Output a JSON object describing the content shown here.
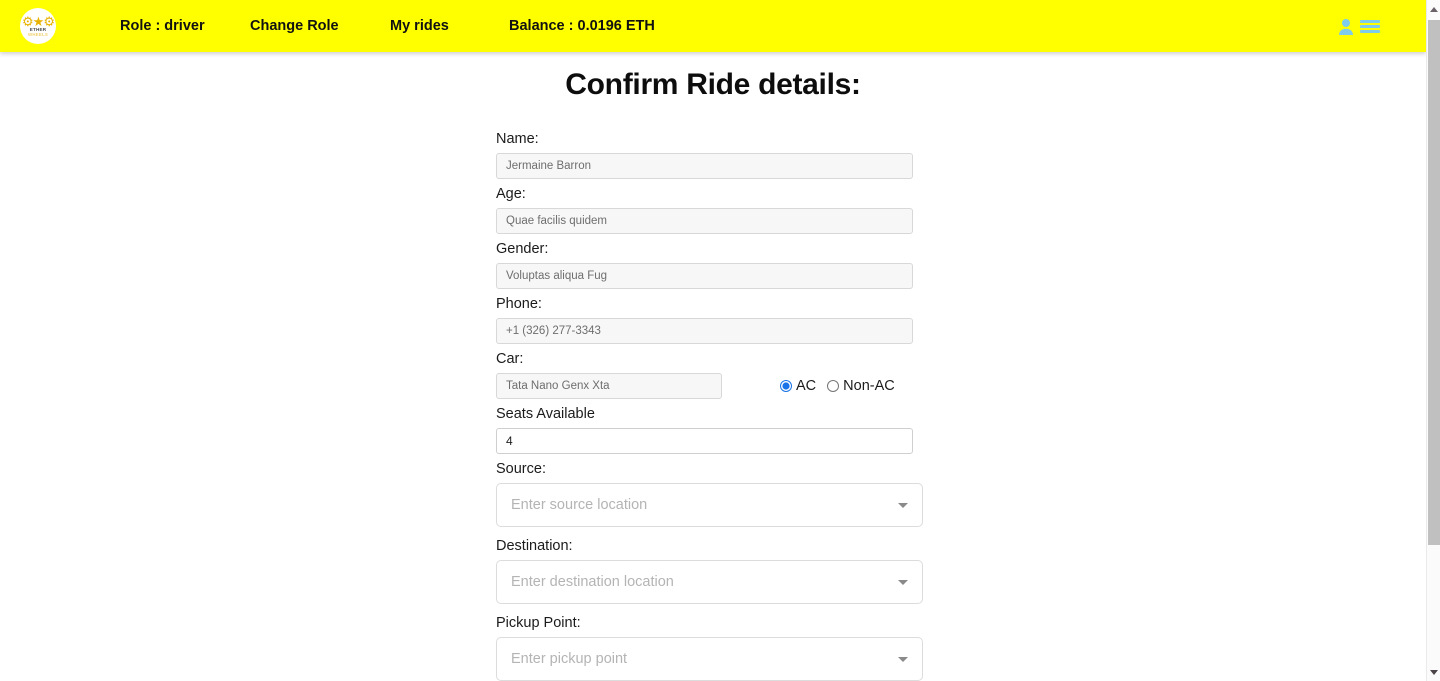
{
  "navbar": {
    "logo": {
      "icon_name": "ether-wheels-logo",
      "line1": "ETHER",
      "line2": "WHEELS"
    },
    "links": [
      {
        "label": "Role : driver",
        "name": "nav-role"
      },
      {
        "label": "Change Role",
        "name": "nav-change-role"
      },
      {
        "label": "My rides",
        "name": "nav-my-rides"
      },
      {
        "label": "Balance : 0.0196 ETH",
        "name": "nav-balance"
      }
    ],
    "user_icon": "user-icon",
    "menu_icon": "hamburger-menu-icon",
    "background_color": "#ffff00",
    "icon_color": "#7ecbea"
  },
  "page": {
    "title": "Confirm Ride details:"
  },
  "form": {
    "name": {
      "label": "Name:",
      "value": "Jermaine Barron"
    },
    "age": {
      "label": "Age:",
      "value": "Quae facilis quidem"
    },
    "gender": {
      "label": "Gender:",
      "value": "Voluptas aliqua Fug"
    },
    "phone": {
      "label": "Phone:",
      "value": "+1 (326) 277-3343"
    },
    "car": {
      "label": "Car:",
      "value": "Tata Nano Genx Xta"
    },
    "ac_options": {
      "selected": "AC",
      "ac_label": "AC",
      "nonac_label": "Non-AC"
    },
    "seats": {
      "label": "Seats Available",
      "value": "4"
    },
    "source": {
      "label": "Source:",
      "placeholder": "Enter source location",
      "value": ""
    },
    "destination": {
      "label": "Destination:",
      "placeholder": "Enter destination location",
      "value": ""
    },
    "pickup": {
      "label": "Pickup Point:",
      "placeholder": "Enter pickup point",
      "value": ""
    }
  },
  "scrollbar": {
    "vertical_name": "vertical-scrollbar",
    "up_arrow": "scroll-up-arrow",
    "down_arrow": "scroll-down-arrow"
  }
}
